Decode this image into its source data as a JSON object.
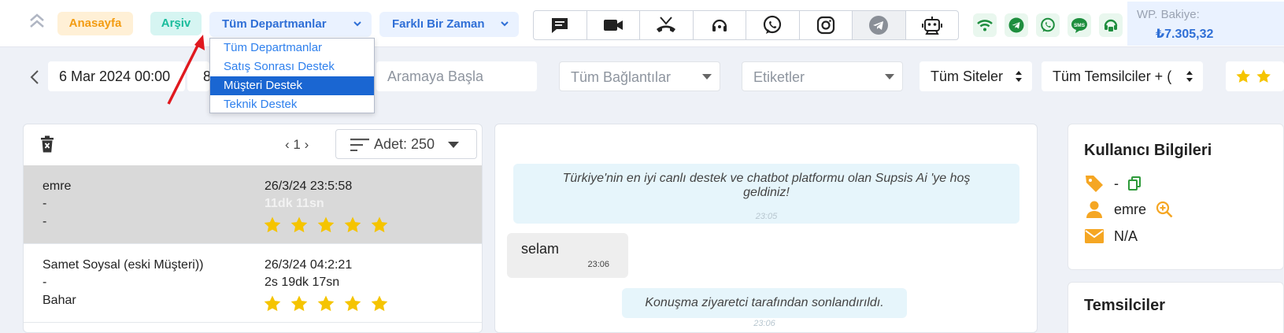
{
  "topbar": {
    "home_label": "Anasayfa",
    "archive_label": "Arşiv",
    "department_select": "Tüm Departmanlar",
    "time_select": "Farklı Bir Zaman",
    "channels": [
      "chat-icon",
      "video-icon",
      "missed-call-icon",
      "headset-icon",
      "whatsapp-icon",
      "instagram-icon",
      "telegram-icon",
      "chatbot-icon"
    ],
    "status_icons": [
      "wifi-icon",
      "telegram-icon",
      "whatsapp-icon",
      "sms-icon",
      "agent-icon"
    ],
    "balance_label": "WP. Bakiye:",
    "balance_value": "₺7.305,32",
    "accent": "#2f6fd6"
  },
  "department_dropdown": {
    "options": [
      "Tüm Departmanlar",
      "Satış Sonrası Destek",
      "Müşteri Destek",
      "Teknik Destek"
    ],
    "highlighted": "Müşteri Destek"
  },
  "filters": {
    "date_start": "6 Mar 2024 00:00",
    "date_end_partial": "8",
    "search_placeholder": "Aramaya Başla",
    "connections_placeholder": "Tüm Bağlantılar",
    "tags_placeholder": "Etiketler",
    "sites": "Tüm Siteler",
    "representatives": "Tüm Temsilciler + (",
    "rating_stars": 2
  },
  "conversation_list": {
    "page": "1",
    "count_label": "Adet: 250",
    "rows": [
      {
        "name": "emre",
        "line2": "-",
        "line3": "-",
        "date": "26/3/24 23:5:58",
        "duration": "11dk 11sn",
        "rating": 5
      },
      {
        "name": "Samet Soysal (eski Müşteri))",
        "line2": "-",
        "line3": "Bahar",
        "date": "26/3/24 04:2:21",
        "duration": "2s 19dk 17sn",
        "rating": 5
      }
    ]
  },
  "chat": {
    "welcome": "Türkiye'nin en iyi canlı destek ve chatbot platformu olan Supsis Ai 'ye hoş geldiniz!",
    "welcome_time": "23:05",
    "message": "selam",
    "message_time": "23:06",
    "ended": "Konuşma ziyaretci tarafından sonlandırıldı.",
    "ended_time": "23:06"
  },
  "user_info": {
    "title": "Kullanıcı Bilgileri",
    "tag": "-",
    "name": "emre",
    "email": "N/A"
  },
  "representatives_panel": {
    "title": "Temsilciler"
  }
}
